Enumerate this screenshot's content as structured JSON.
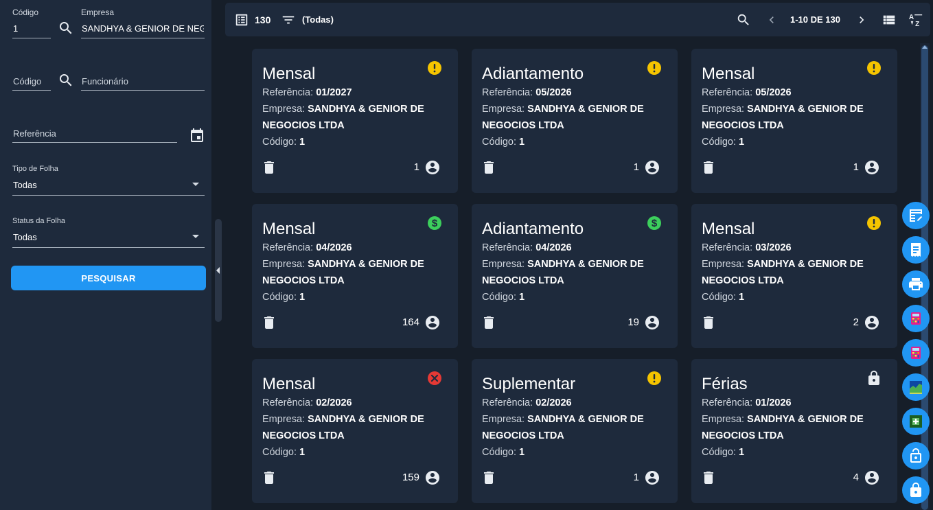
{
  "filters": {
    "empresa_codigo": {
      "label": "Código",
      "value": "1"
    },
    "empresa": {
      "label": "Empresa",
      "value": "SANDHYA & GENIOR DE NEGO"
    },
    "funcionario_codigo": {
      "placeholder": "Código"
    },
    "funcionario": {
      "placeholder": "Funcionário"
    },
    "referencia": {
      "placeholder": "Referência"
    },
    "tipo_folha": {
      "label": "Tipo de Folha",
      "value": "Todas"
    },
    "status_folha": {
      "label": "Status da Folha",
      "value": "Todas"
    },
    "search_button": "PESQUISAR"
  },
  "toolbar": {
    "total": "130",
    "filter_label": "(Todas)",
    "pagination": "1-10 DE 130"
  },
  "labels": {
    "referencia": "Referência:",
    "empresa": "Empresa:",
    "codigo": "Código:"
  },
  "colors": {
    "accent": "#2196f3",
    "warning": "#f5c400",
    "paid": "#3ccf5c",
    "error": "#e53935",
    "card_bg": "#1e2a3c",
    "page_bg": "#161e29"
  },
  "cards": [
    {
      "title": "Mensal",
      "referencia": "01/2027",
      "empresa_l1": "SANDHYA & GENIOR DE",
      "empresa_l2": "NEGOCIOS LTDA",
      "codigo": "1",
      "count": "1",
      "status_icon": "alert-circle-icon"
    },
    {
      "title": "Adiantamento",
      "referencia": "05/2026",
      "empresa_l1": "SANDHYA & GENIOR DE",
      "empresa_l2": "NEGOCIOS LTDA",
      "codigo": "1",
      "count": "1",
      "status_icon": "alert-circle-icon"
    },
    {
      "title": "Mensal",
      "referencia": "05/2026",
      "empresa_l1": "SANDHYA & GENIOR DE",
      "empresa_l2": "NEGOCIOS LTDA",
      "codigo": "1",
      "count": "1",
      "status_icon": "alert-circle-icon"
    },
    {
      "title": "Mensal",
      "referencia": "04/2026",
      "empresa_l1": "SANDHYA & GENIOR DE",
      "empresa_l2": "NEGOCIOS LTDA",
      "codigo": "1",
      "count": "164",
      "status_icon": "dollar-circle-icon"
    },
    {
      "title": "Adiantamento",
      "referencia": "04/2026",
      "empresa_l1": "SANDHYA & GENIOR DE",
      "empresa_l2": "NEGOCIOS LTDA",
      "codigo": "1",
      "count": "19",
      "status_icon": "dollar-circle-icon"
    },
    {
      "title": "Mensal",
      "referencia": "03/2026",
      "empresa_l1": "SANDHYA & GENIOR DE",
      "empresa_l2": "NEGOCIOS LTDA",
      "codigo": "1",
      "count": "2",
      "status_icon": "alert-circle-icon"
    },
    {
      "title": "Mensal",
      "referencia": "02/2026",
      "empresa_l1": "SANDHYA & GENIOR DE",
      "empresa_l2": "NEGOCIOS LTDA",
      "codigo": "1",
      "count": "159",
      "status_icon": "close-circle-icon"
    },
    {
      "title": "Suplementar",
      "referencia": "02/2026",
      "empresa_l1": "SANDHYA & GENIOR DE",
      "empresa_l2": "NEGOCIOS LTDA",
      "codigo": "1",
      "count": "1",
      "status_icon": "alert-circle-icon"
    },
    {
      "title": "Férias",
      "referencia": "01/2026",
      "empresa_l1": "SANDHYA & GENIOR DE",
      "empresa_l2": "NEGOCIOS LTDA",
      "codigo": "1",
      "count": "4",
      "status_icon": "lock-icon"
    }
  ],
  "fabs": [
    "table-edit-icon",
    "receipt-icon",
    "printer-icon",
    "calculator-icon",
    "calculator-icon",
    "chart-area-icon",
    "add-box-icon",
    "lock-open-icon",
    "lock-icon"
  ]
}
